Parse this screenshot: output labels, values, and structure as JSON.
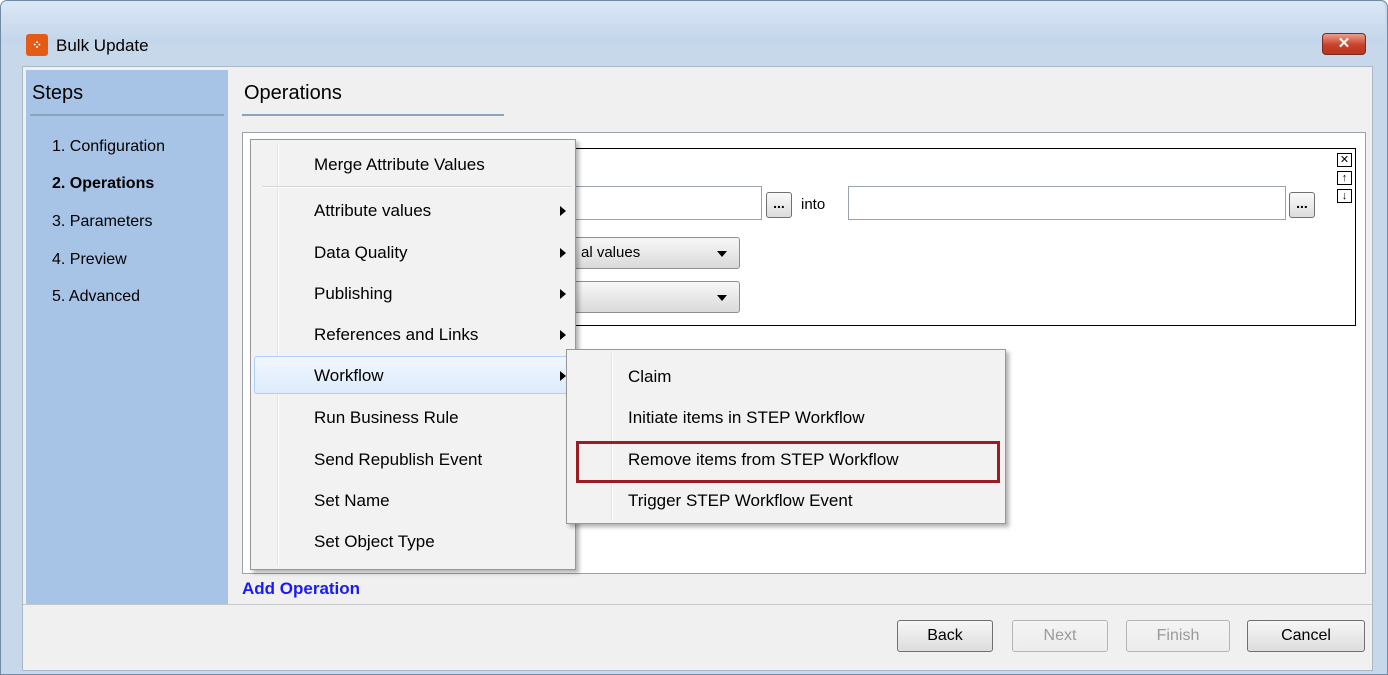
{
  "window": {
    "title": "Bulk Update",
    "close_glyph": "✕"
  },
  "steps": {
    "title": "Steps",
    "items": [
      {
        "label": "1. Configuration",
        "current": false
      },
      {
        "label": "2. Operations",
        "current": true
      },
      {
        "label": "3. Parameters",
        "current": false
      },
      {
        "label": "4. Preview",
        "current": false
      },
      {
        "label": "5. Advanced",
        "current": false
      }
    ]
  },
  "operations": {
    "title": "Operations",
    "into_label": "into",
    "browse_label": "...",
    "combo1_text": "al values",
    "combo2_text": "",
    "add_operation": "Add Operation"
  },
  "context_menu": {
    "items": [
      {
        "label": "Merge Attribute Values",
        "submenu": false
      },
      {
        "label": "Attribute values",
        "submenu": true
      },
      {
        "label": "Data Quality",
        "submenu": true
      },
      {
        "label": "Publishing",
        "submenu": true
      },
      {
        "label": "References and Links",
        "submenu": true
      },
      {
        "label": "Workflow",
        "submenu": true,
        "hovered": true
      },
      {
        "label": "Run Business Rule",
        "submenu": false
      },
      {
        "label": "Send Republish Event",
        "submenu": false
      },
      {
        "label": "Set Name",
        "submenu": false
      },
      {
        "label": "Set Object Type",
        "submenu": false
      }
    ]
  },
  "workflow_submenu": {
    "items": [
      {
        "label": "Claim"
      },
      {
        "label": "Initiate items in STEP Workflow"
      },
      {
        "label": "Remove items from STEP Workflow",
        "highlighted": true
      },
      {
        "label": "Trigger STEP Workflow Event"
      }
    ]
  },
  "footer": {
    "back": "Back",
    "next": "Next",
    "finish": "Finish",
    "cancel": "Cancel"
  },
  "colors": {
    "highlight_border": "#9c1c24",
    "link": "#1a1af5",
    "steps_panel": "#a7c4e6"
  }
}
